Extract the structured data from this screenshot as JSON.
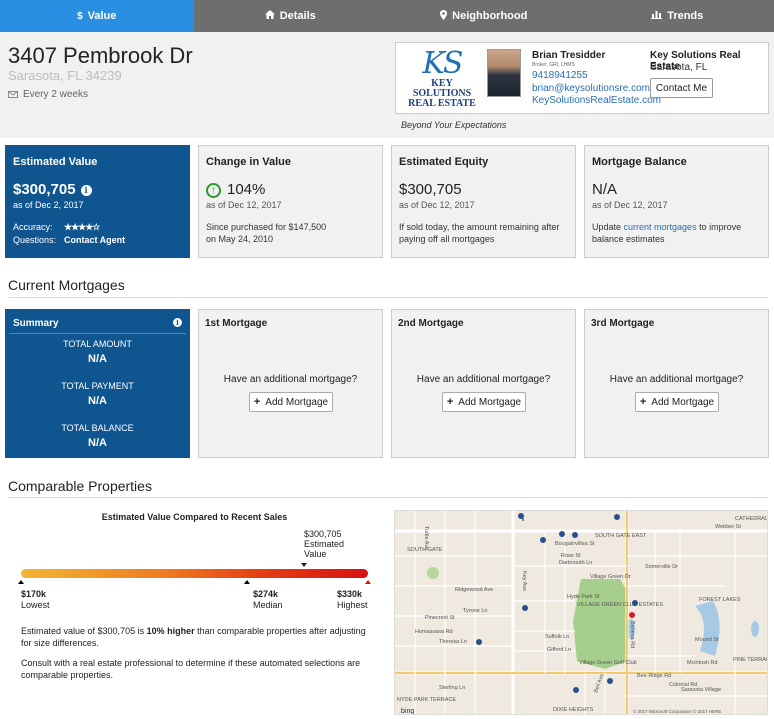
{
  "tabs": [
    {
      "label": "Value",
      "icon": "$"
    },
    {
      "label": "Details",
      "icon": "home-icon"
    },
    {
      "label": "Neighborhood",
      "icon": "map-pin-icon"
    },
    {
      "label": "Trends",
      "icon": "bar-chart-icon"
    }
  ],
  "property": {
    "address": "3407 Pembrook Dr",
    "city_state_zip": "Sarasota, FL 34239",
    "frequency": "Every 2 weeks"
  },
  "agent": {
    "logo_initials": "KS",
    "logo_line1": "KEY SOLUTIONS",
    "logo_line2": "REAL ESTATE",
    "name": "Brian Tresidder",
    "title": "Broker, GRI, LHMS",
    "phone": "9418941255",
    "email": "brian@keysolutionsre.com",
    "website": "KeySolutionsRealEstate.com",
    "company": "Key Solutions Real Estate",
    "company_city": "Sarasota, FL",
    "contact_label": "Contact Me",
    "tagline": "Beyond Your Expectations"
  },
  "cards": {
    "estimated": {
      "title": "Estimated Value",
      "value": "$300,705",
      "as_of": "as of Dec 2, 2017",
      "accuracy_label": "Accuracy:",
      "accuracy_stars": "★★★★☆",
      "questions_label": "Questions:",
      "questions_value": "Contact Agent"
    },
    "change": {
      "title": "Change in Value",
      "value": "104%",
      "as_of": "as of Dec 12, 2017",
      "desc1": "Since purchased for $147,500",
      "desc2": "on May 24, 2010"
    },
    "equity": {
      "title": "Estimated Equity",
      "value": "$300,705",
      "as_of": "as of Dec 12, 2017",
      "desc": "If sold today, the amount remaining after paying off all mortgages"
    },
    "mortgage_balance": {
      "title": "Mortgage Balance",
      "value": "N/A",
      "as_of": "as of Dec 12, 2017",
      "desc_pre": "Update ",
      "desc_link": "current mortgages",
      "desc_post": " to improve balance estimates"
    }
  },
  "mortgages": {
    "section_title": "Current Mortgages",
    "summary": {
      "title": "Summary",
      "total_amount_label": "TOTAL AMOUNT",
      "total_amount": "N/A",
      "total_payment_label": "TOTAL PAYMENT",
      "total_payment": "N/A",
      "total_balance_label": "TOTAL BALANCE",
      "total_balance": "N/A"
    },
    "slots": [
      {
        "title": "1st Mortgage",
        "question": "Have an additional mortgage?",
        "button": "Add Mortgage"
      },
      {
        "title": "2nd Mortgage",
        "question": "Have an additional mortgage?",
        "button": "Add Mortgage"
      },
      {
        "title": "3rd Mortgage",
        "question": "Have an additional mortgage?",
        "button": "Add Mortgage"
      }
    ]
  },
  "comparable": {
    "section_title": "Comparable Properties",
    "heading": "Estimated Value Compared to Recent Sales",
    "estimated_value": "$300,705",
    "estimated_label1": "Estimated",
    "estimated_label2": "Value",
    "lowest_value": "$170k",
    "lowest_label": "Lowest",
    "median_value": "$274k",
    "median_label": "Median",
    "highest_value": "$330k",
    "highest_label": "Highest",
    "scale": {
      "low": 170,
      "median": 274,
      "estimate": 300.705,
      "high": 330
    },
    "text1_pre": "Estimated value of $300,705 is ",
    "text1_bold": "10% higher",
    "text1_post": " than comparable properties after adjusting for size differences.",
    "text2": "Consult with a real estate professional to determine if these automated selections are comparable properties."
  },
  "map": {
    "labels": [
      "SOUTH GATE",
      "SOUTH GATE EAST",
      "Webber St",
      "CATHEDRAL",
      "Bougainvillea St",
      "Rose St",
      "Dartmouth Ln",
      "Village Green Dr",
      "Somerville Dr",
      "Hyde Park St",
      "VILLAGE GREEN CLUB ESTATES",
      "Pinecrest St",
      "Homassasa Rd",
      "Theresa Ln",
      "Tyrone Ln",
      "Suffolk Ln",
      "Gifford Ln",
      "Village Green Golf Club",
      "Bee Ridge Rd",
      "Beneva Rd",
      "Key Ave",
      "FOREST LAKES",
      "PINE TERRACE",
      "Mcintosh Rd",
      "Colonial Rd",
      "DIXIE HEIGHTS",
      "NYDE PARK TERRACE",
      "Sterling Ln",
      "Bell Ave",
      "Sarasota Village",
      "Mound St",
      "Ridgewood Ave",
      "Tuttle Ave",
      "© 2017 Microsoft Corporation © 2017 HERE",
      "bing"
    ]
  }
}
